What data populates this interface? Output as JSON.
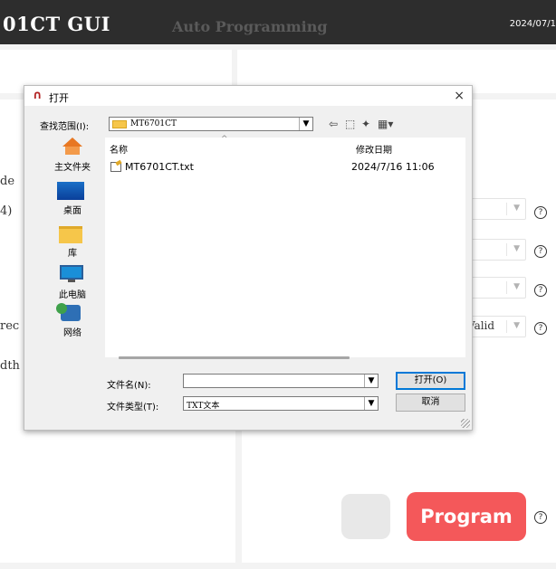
{
  "app": {
    "title": "01CT GUI",
    "mode": "Auto Programming",
    "date": "2024/07/1"
  },
  "left_panel": {
    "label_1": "de",
    "label_2": "4)",
    "label_3": "rec",
    "label_4": "dth"
  },
  "right_panel": {
    "dropdown_4_value": "Valid",
    "help_glyph": "?",
    "program_label": "Program",
    "program_color": "#f4585a"
  },
  "dialog": {
    "title": "打开",
    "close_glyph": "×",
    "look_in_label": "查找范围(I):",
    "look_in_value": "MT6701CT",
    "places": [
      "主文件夹",
      "桌面",
      "库",
      "此电脑",
      "网络"
    ],
    "columns": [
      "名称",
      "修改日期"
    ],
    "files": [
      {
        "name": "MT6701CT.txt",
        "modified": "2024/7/16 11:06"
      }
    ],
    "file_name_label": "文件名(N):",
    "file_name_value": "",
    "file_type_label": "文件类型(T):",
    "file_type_value": "TXT文本",
    "open_button": "打开(O)",
    "cancel_button": "取消"
  }
}
